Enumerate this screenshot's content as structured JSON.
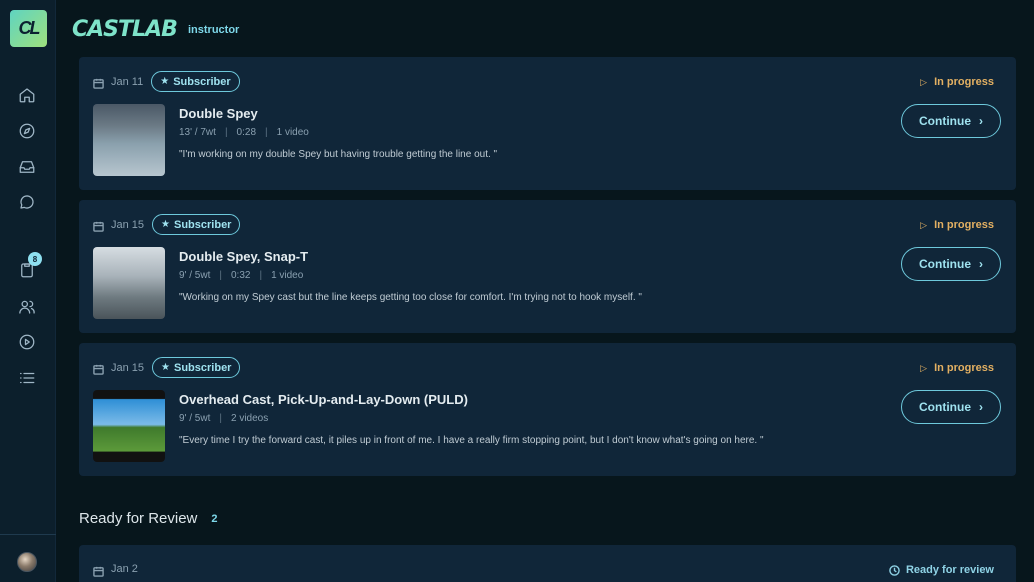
{
  "app": {
    "logo_text": "CL",
    "brand": "CASTLAB",
    "role": "instructor"
  },
  "sidebar": {
    "items": [
      {
        "name": "home-icon"
      },
      {
        "name": "compass-icon"
      },
      {
        "name": "inbox-icon"
      },
      {
        "name": "chat-icon"
      },
      {
        "name": "clipboard-icon",
        "badge": "8"
      },
      {
        "name": "users-icon"
      },
      {
        "name": "play-circle-icon"
      },
      {
        "name": "list-icon"
      }
    ]
  },
  "in_progress": [
    {
      "date": "Jan 11",
      "tag": "Subscriber",
      "status": "In progress",
      "title": "Double Spey",
      "meta": [
        "13' / 7wt",
        "0:28",
        "1 video"
      ],
      "quote": "\"I'm working on my double Spey but having trouble getting the line out. \"",
      "action": "Continue"
    },
    {
      "date": "Jan 15",
      "tag": "Subscriber",
      "status": "In progress",
      "title": "Double Spey, Snap-T",
      "meta": [
        "9' / 5wt",
        "0:32",
        "1 video"
      ],
      "quote": "\"Working on my Spey cast but the line keeps getting too close for comfort. I'm trying not to hook myself. \"",
      "action": "Continue"
    },
    {
      "date": "Jan 15",
      "tag": "Subscriber",
      "status": "In progress",
      "title": "Overhead Cast, Pick-Up-and-Lay-Down (PULD)",
      "meta": [
        "9' / 5wt",
        "2 videos"
      ],
      "quote": "\"Every time I try the forward cast, it piles up in front of me. I have a really firm stopping point, but I don't know what's going on here. \"",
      "action": "Continue"
    }
  ],
  "ready_for_review": {
    "title": "Ready for Review",
    "count": "2",
    "first_item": {
      "date": "Jan 2",
      "status": "Ready for review"
    }
  },
  "colors": {
    "background": "#07161c",
    "card": "#102639",
    "accent": "#6ec9dc",
    "in_progress": "#e3b062",
    "brand": "#7ee3c9"
  }
}
